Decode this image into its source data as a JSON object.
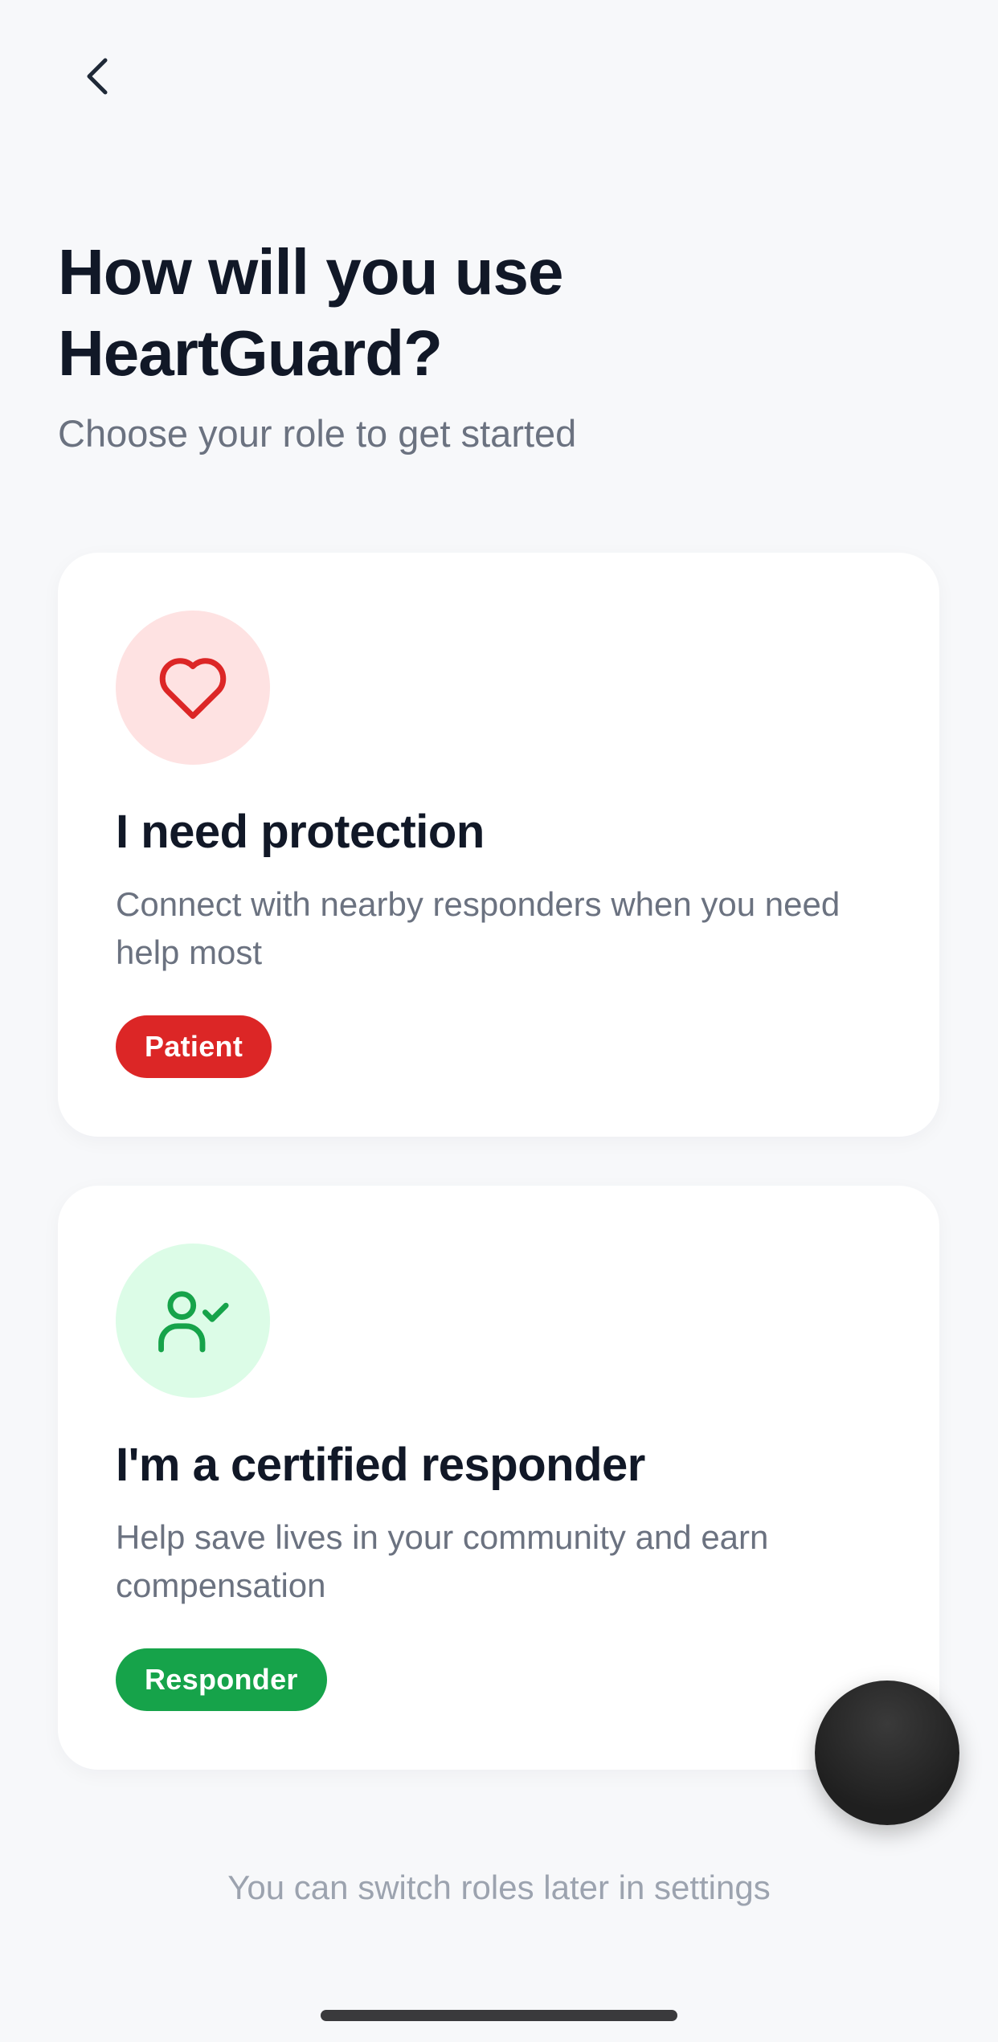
{
  "header": {
    "back_icon": "chevron-left-icon",
    "title": "How will you use HeartGuard?",
    "subtitle": "Choose your role to get started"
  },
  "roles": [
    {
      "icon": "heart-icon",
      "icon_color": "#dc2626",
      "icon_bg": "#fee2e2",
      "title": "I need protection",
      "description": "Connect with nearby responders when you need help most",
      "badge": "Patient",
      "badge_color": "#dc2626"
    },
    {
      "icon": "user-check-icon",
      "icon_color": "#16a34a",
      "icon_bg": "#dcfce7",
      "title": "I'm a certified responder",
      "description": "Help save lives in your community and earn compensation",
      "badge": "Responder",
      "badge_color": "#16a34a"
    }
  ],
  "footer": {
    "note": "You can switch roles later in settings"
  }
}
